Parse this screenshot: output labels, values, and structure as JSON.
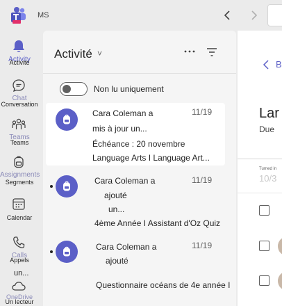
{
  "topbar": {
    "app_icon": "teams-new-icon",
    "org_chip": "MS",
    "back_icon": "chevron-left-icon",
    "forward_icon": "chevron-right-icon"
  },
  "rail": {
    "items": [
      {
        "id": "activity",
        "icon": "bell-icon",
        "ghost": "Activity",
        "label": "Activité",
        "active": true
      },
      {
        "id": "chat",
        "icon": "chat-icon",
        "ghost": "Chat",
        "label": "Conversation",
        "active": false
      },
      {
        "id": "teams",
        "icon": "teams-icon",
        "ghost": "Teams",
        "label": "Teams",
        "active": false
      },
      {
        "id": "assignments",
        "icon": "backpack-icon",
        "ghost": "Assignments",
        "label": "Segments",
        "active": false
      },
      {
        "id": "calendar",
        "icon": "calendar-icon",
        "ghost": "",
        "label": "Calendar",
        "active": false
      },
      {
        "id": "calls",
        "icon": "phone-icon",
        "ghost": "Calls",
        "label": "Appels",
        "active": false
      },
      {
        "id": "onedrive",
        "icon": "cloud-icon",
        "ghost": "OneDrive",
        "label": "Un lecteur",
        "active": false
      }
    ],
    "extra_label": "un..."
  },
  "panel": {
    "title": "Activité",
    "caret": "˅",
    "more_icon": "more-horizontal-icon",
    "filter_icon": "filter-icon",
    "toggle_label": "Non lu uniquement",
    "feed": [
      {
        "line1": "Cara Coleman a",
        "line2": "mis à jour un...",
        "line3": "Échéance : 20 novembre",
        "line4": "Language Arts I Language Art...",
        "date": "11/19",
        "selected": true
      },
      {
        "line1": "Cara Coleman a",
        "line2": "ajouté",
        "line3": "un...",
        "line4": "4ème Année I Assistant d'Oz Quiz",
        "date": "11/19",
        "selected": false
      },
      {
        "line1": "Cara Coleman a",
        "line2": "ajouté",
        "line3": "",
        "line4": "Questionnaire océans de 4e année I",
        "date": "11/19",
        "selected": false
      }
    ]
  },
  "detail": {
    "back_label": "B",
    "title": "Lar",
    "due": "Due",
    "col_header": "Turned in",
    "col_value": "10/3"
  },
  "colors": {
    "brand": "#5b5fc7",
    "background": "#ebebeb",
    "panel": "#f5f5f5"
  }
}
